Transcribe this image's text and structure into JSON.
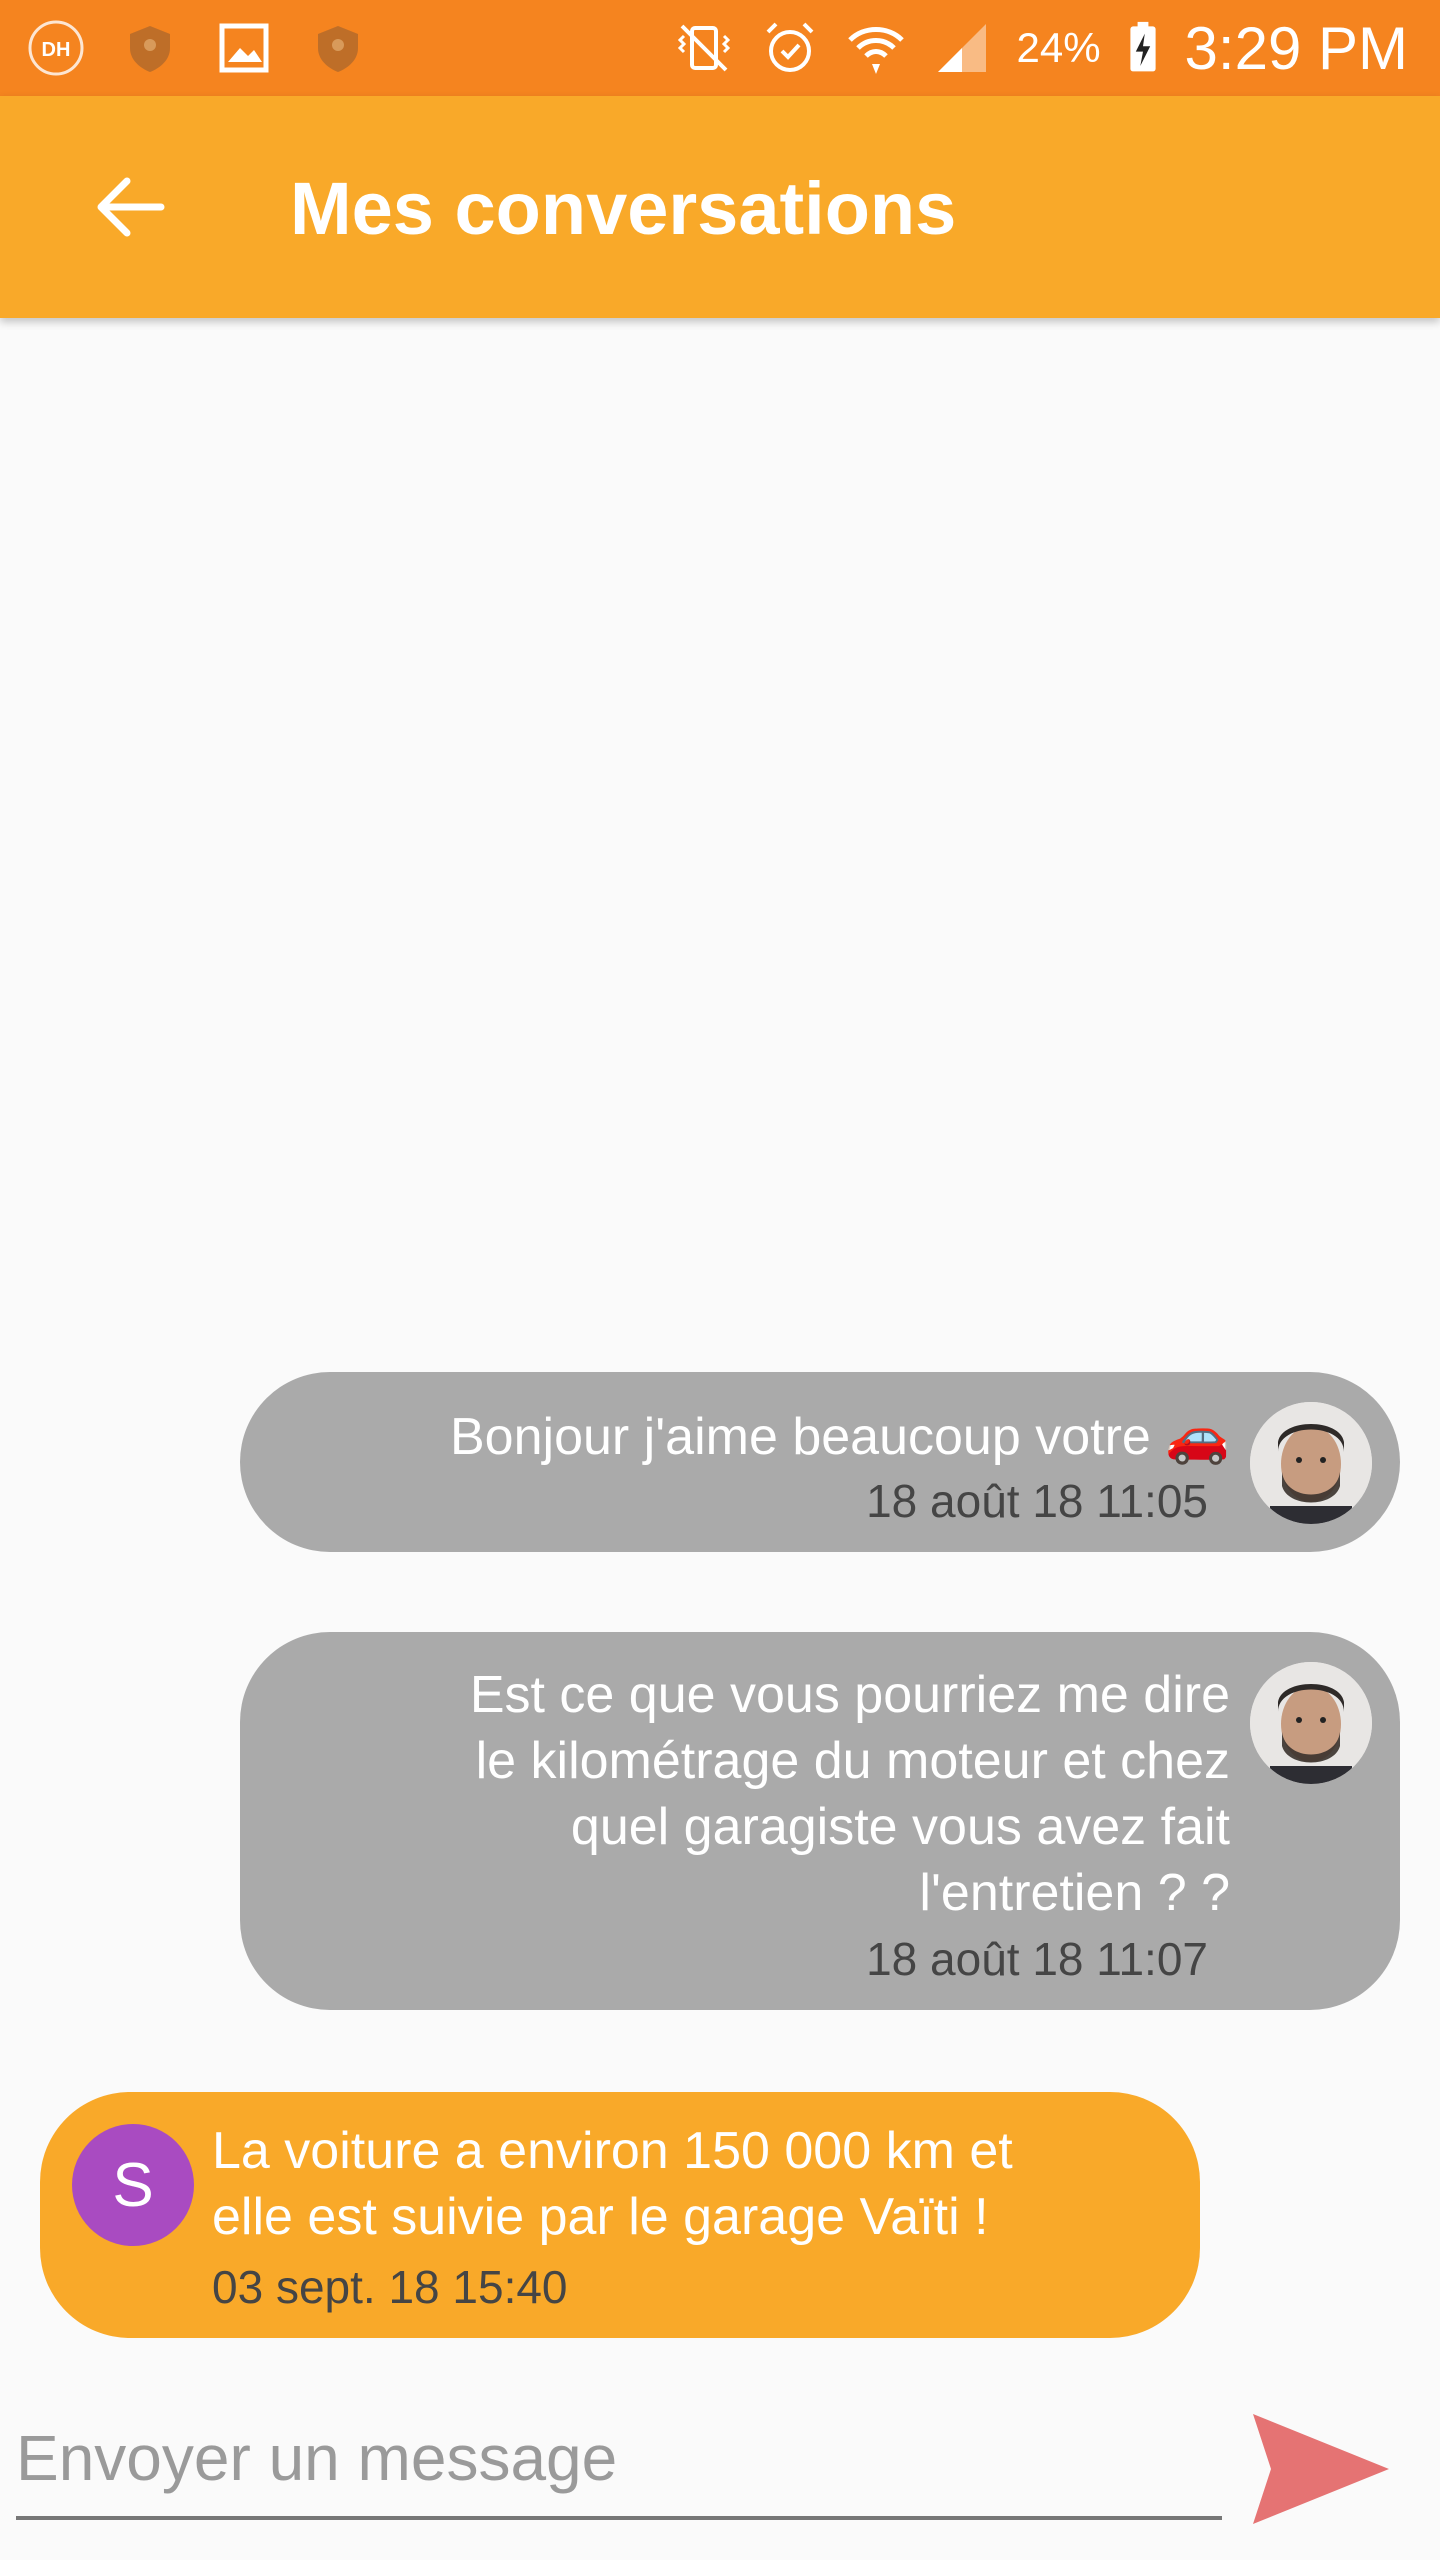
{
  "status_bar": {
    "battery": "24%",
    "time": "3:29 PM",
    "icons_left": [
      "disney-hotstar-icon",
      "shield-icon",
      "image-icon",
      "shield-icon"
    ],
    "icons_right": [
      "vibrate-mute-icon",
      "alarm-icon",
      "wifi-icon",
      "signal-icon",
      "battery-charging-icon"
    ]
  },
  "header": {
    "title": "Mes conversations",
    "back_icon": "arrow-back-icon"
  },
  "messages": [
    {
      "side": "mine",
      "lines": [
        "Bonjour j'aime beaucoup votre 🚗"
      ],
      "time": "18 août 18 11:05",
      "avatar": "user-photo"
    },
    {
      "side": "mine",
      "lines": [
        "Est ce que vous pourriez me dire",
        "le kilométrage du moteur et chez",
        "quel garagiste vous avez fait",
        "l'entretien ? ?"
      ],
      "time": "18 août 18 11:07",
      "avatar": "user-photo"
    },
    {
      "side": "theirs",
      "lines": [
        "La voiture a environ 150 000 km et",
        "elle est suivie par le garage Vaïti !"
      ],
      "time": "03 sept. 18 15:40",
      "avatar_letter": "S"
    }
  ],
  "composer": {
    "placeholder": "Envoyer un message",
    "value": "",
    "send_icon": "send-icon"
  },
  "colors": {
    "status_bar": "#f5841f",
    "app_bar": "#f9a929",
    "my_bubble": "#aaaaaa",
    "their_bubble": "#f9a929",
    "avatar_letter_bg": "#a94bc1",
    "send_icon": "#e57373"
  }
}
